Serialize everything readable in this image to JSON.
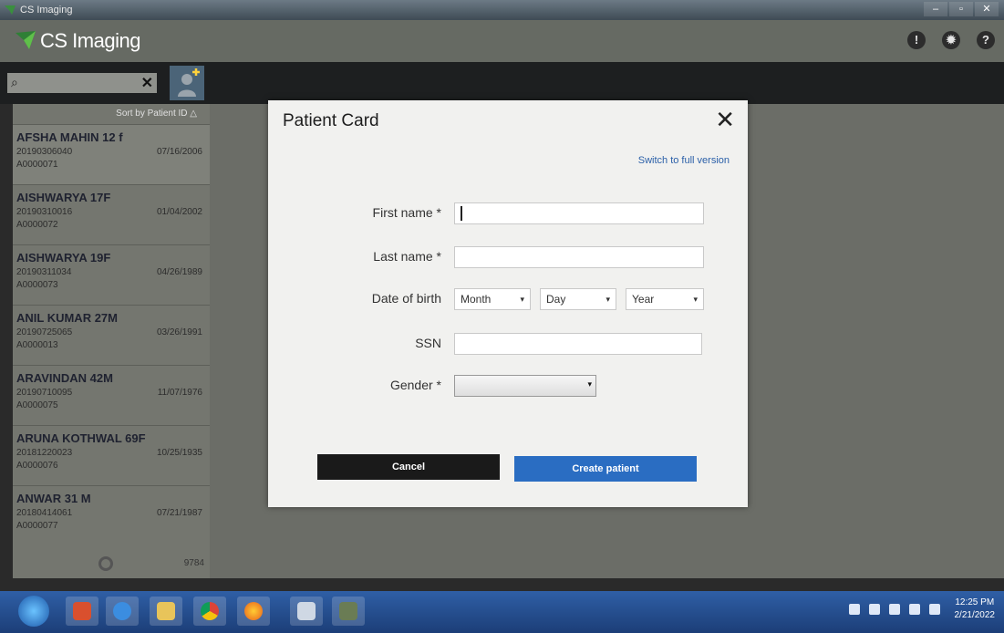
{
  "window": {
    "title": "CS Imaging",
    "controls": [
      "–",
      "▫",
      "✕"
    ]
  },
  "header": {
    "app_name": "CS Imaging",
    "icons": [
      "info-icon",
      "gear-icon",
      "help-icon"
    ],
    "info_glyph": "!",
    "gear_glyph": "✹",
    "help_glyph": "?"
  },
  "search": {
    "placeholder": "",
    "search_glyph": "⌕",
    "clear_glyph": "✕"
  },
  "sidebar": {
    "sort_label": "Sort by Patient ID",
    "patients": [
      {
        "name": "AFSHA MAHIN 12 f",
        "id": "20190306040",
        "acc": "A0000071",
        "dob": "07/16/2006"
      },
      {
        "name": "AISHWARYA 17F",
        "id": "20190310016",
        "acc": "A0000072",
        "dob": "01/04/2002"
      },
      {
        "name": "AISHWARYA 19F",
        "id": "20190311034",
        "acc": "A0000073",
        "dob": "04/26/1989"
      },
      {
        "name": "ANIL KUMAR 27M",
        "id": "20190725065",
        "acc": "A0000013",
        "dob": "03/26/1991"
      },
      {
        "name": "ARAVINDAN 42M",
        "id": "20190710095",
        "acc": "A0000075",
        "dob": "11/07/1976"
      },
      {
        "name": "ARUNA KOTHWAL 69F",
        "id": "20181220023",
        "acc": "A0000076",
        "dob": "10/25/1935"
      },
      {
        "name": "ANWAR 31 M",
        "id": "20180414061",
        "acc": "A0000077",
        "dob": "07/21/1987"
      }
    ],
    "count": "9784"
  },
  "dialog": {
    "title": "Patient Card",
    "close_glyph": "✕",
    "switch_link": "Switch to full version",
    "fields": {
      "first_name": {
        "label": "First name *",
        "value": ""
      },
      "last_name": {
        "label": "Last name *",
        "value": ""
      },
      "dob": {
        "label": "Date of birth",
        "month": "Month",
        "day": "Day",
        "year": "Year"
      },
      "ssn": {
        "label": "SSN",
        "value": ""
      },
      "gender": {
        "label": "Gender *",
        "value": ""
      }
    },
    "cancel_label": "Cancel",
    "create_label": "Create patient",
    "dropdown_glyph": "▾"
  },
  "taskbar": {
    "apps": [
      "windows-start",
      "powerpoint",
      "internet-explorer",
      "file-explorer",
      "chrome",
      "firefox",
      "notepad",
      "cs-imaging"
    ],
    "time": "12:25 PM",
    "date": "2/21/2022"
  }
}
